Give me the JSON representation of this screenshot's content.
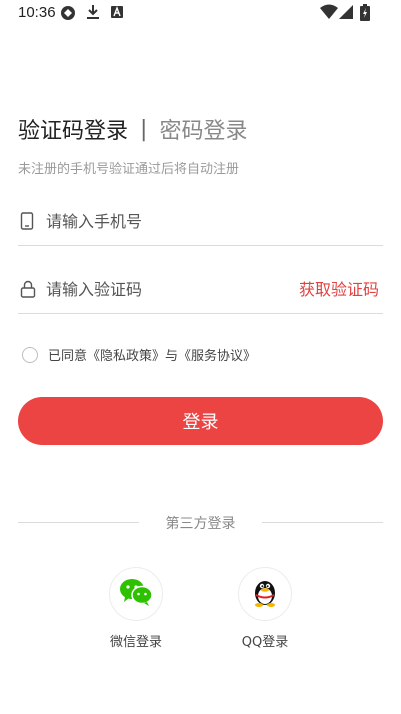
{
  "status_bar": {
    "time": "10:36"
  },
  "tabs": {
    "active": "验证码登录",
    "divider": "|",
    "inactive": "密码登录"
  },
  "hint": "未注册的手机号验证通过后将自动注册",
  "phone_field": {
    "placeholder": "请输入手机号",
    "icon": "phone-icon"
  },
  "code_field": {
    "placeholder": "请输入验证码",
    "icon": "lock-icon",
    "action_label": "获取验证码"
  },
  "agreement": {
    "text": "已同意《隐私政策》与《服务协议》"
  },
  "login_button": "登录",
  "third_party": {
    "label": "第三方登录",
    "providers": [
      {
        "name": "微信登录",
        "icon": "wechat-icon"
      },
      {
        "name": "QQ登录",
        "icon": "qq-icon"
      }
    ]
  },
  "colors": {
    "accent": "#ec4343",
    "link": "#e34040",
    "wechat": "#2dc100"
  }
}
